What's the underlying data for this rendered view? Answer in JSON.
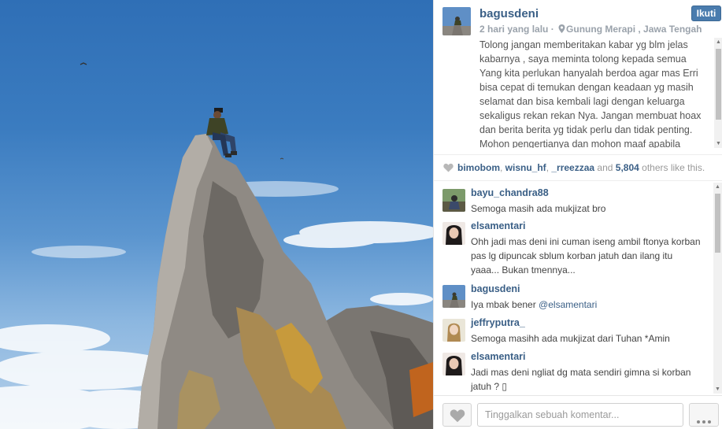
{
  "post": {
    "username": "bagusdeni",
    "follow_label": "Ikuti",
    "time": "2 hari yang lalu",
    "separator": " · ",
    "location": "Gunung Merapi , Jawa Tengah",
    "caption": "Tolong jangan memberitakan kabar yg blm jelas kabarnya , saya meminta tolong kepada semua Yang kita perlukan hanyalah berdoa agar mas Erri bisa cepat di temukan dengan keadaan yg masih selamat dan bisa kembali lagi dengan keluarga sekaligus rekan rekan Nya. Jangan membuat hoax dan berita berita yg tidak perlu dan tidak penting. Mohon pengertianya dan mohon maaf apabila"
  },
  "likes": {
    "users": [
      "bimobom",
      "wisnu_hf",
      "_rreezzaa"
    ],
    "sep1": ", ",
    "sep2": ", ",
    "and_text": " and ",
    "count": "5,804",
    "others_text": " others like this."
  },
  "comments": [
    {
      "name": "bayu_chandra88",
      "text": "Semoga masih ada mukjizat bro"
    },
    {
      "name": "elsamentari",
      "text": "Ohh jadi mas deni ini cuman iseng ambil ftonya korban pas lg dipuncak sblum korban jatuh dan ilang itu yaaa... Bukan tmennya..."
    },
    {
      "name": "bagusdeni",
      "text": "Iya mbak bener ",
      "mention": "@elsamentari"
    },
    {
      "name": "jeffryputra_",
      "text": "Semoga masihh ada mukjizat dari Tuhan *Amin"
    },
    {
      "name": "elsamentari",
      "text": "Jadi mas deni ngliat dg mata sendiri gimna si korban jatuh ? ▯"
    }
  ],
  "footer": {
    "comment_placeholder": "Tinggalkan sebuah komentar..."
  },
  "icons": {
    "like": "heart-icon",
    "location": "location-pin-icon",
    "more": "ellipsis-icon"
  },
  "colors": {
    "link": "#3a5f86",
    "follow_button": "#4a7cae"
  }
}
